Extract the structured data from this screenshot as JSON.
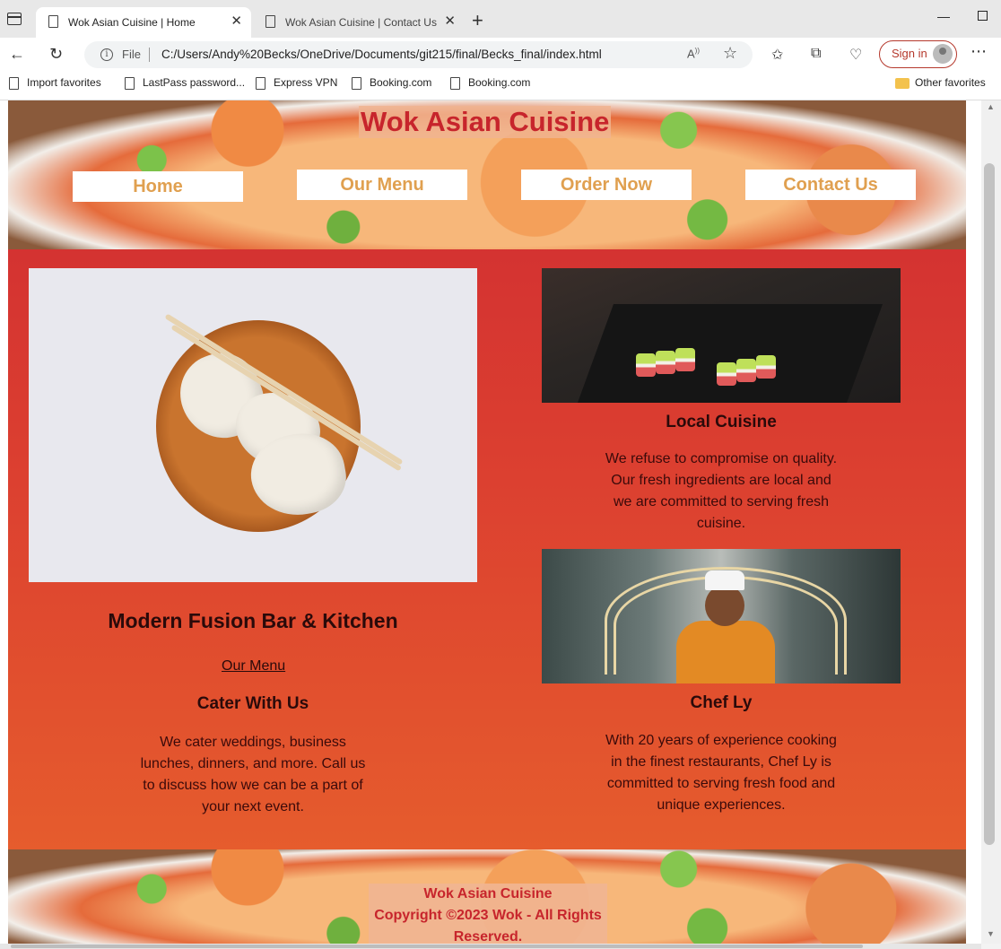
{
  "browser": {
    "tabs": [
      {
        "title": "Wok Asian Cuisine | Home",
        "active": true
      },
      {
        "title": "Wok Asian Cuisine | Contact Us",
        "active": false
      }
    ],
    "address": {
      "scheme_label": "File",
      "url": "C:/Users/Andy%20Becks/OneDrive/Documents/git215/final/Becks_final/index.html"
    },
    "sign_in_label": "Sign in",
    "favorites": [
      "Import favorites",
      "LastPass password...",
      "Express VPN",
      "Booking.com",
      "Booking.com"
    ],
    "other_favorites": "Other favorites"
  },
  "site": {
    "title": "Wok Asian Cuisine",
    "nav": [
      "Home",
      "Our Menu",
      "Order Now",
      "Contact Us"
    ],
    "left": {
      "heading": "Modern Fusion Bar & Kitchen",
      "menu_link": "Our Menu",
      "cater_heading": "Cater With Us",
      "cater_text": "We cater weddings, business lunches, dinners, and more. Call us to discuss how we can be a part of your next event."
    },
    "right": {
      "local_heading": "Local Cuisine",
      "local_text": "We refuse to compromise on quality. Our fresh ingredients are local and we are committed to serving fresh cuisine.",
      "chef_heading": "Chef Ly",
      "chef_text": "With 20 years of experience cooking in the finest restaurants, Chef Ly is committed to serving fresh food and unique experiences."
    },
    "footer": {
      "name": "Wok Asian Cuisine",
      "copyright": "Copyright ©2023 Wok - All Rights Reserved."
    }
  },
  "colors": {
    "brand_red": "#c7252c",
    "nav_text": "#e0a050",
    "gradient_top": "#cf2a32",
    "gradient_bottom": "#e8632c"
  }
}
